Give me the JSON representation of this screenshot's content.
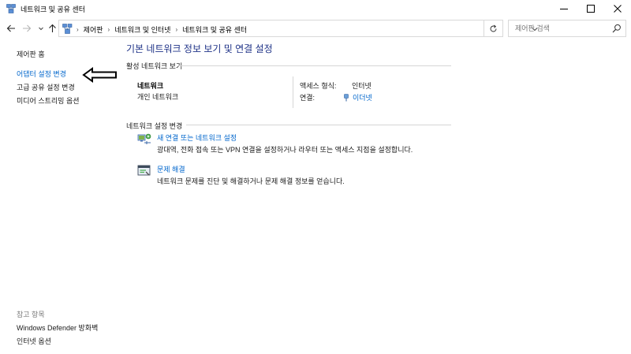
{
  "window": {
    "title": "네트워크 및 공유 센터"
  },
  "address": {
    "breadcrumbs": [
      "제어판",
      "네트워크 및 인터넷",
      "네트워크 및 공유 센터"
    ],
    "search_placeholder": "제어판 검색"
  },
  "left_pane": {
    "home": "제어판 홈",
    "links": [
      "어댑터 설정 변경",
      "고급 공유 설정 변경",
      "미디어 스트리밍 옵션"
    ],
    "see_also_header": "참고 항목",
    "see_also": [
      "Windows Defender 방화벽",
      "인터넷 옵션"
    ]
  },
  "main": {
    "title": "기본 네트워크 정보 보기 및 연결 설정",
    "active_networks_header": "활성 네트워크 보기",
    "network": {
      "name": "네트워크",
      "type": "개인 네트워크",
      "access_label": "액세스 형식:",
      "access_value": "인터넷",
      "connection_label": "연결:",
      "connection_value": "이더넷"
    },
    "change_settings_header": "네트워크 설정 변경",
    "tasks": [
      {
        "link": "새 연결 또는 네트워크 설정",
        "desc": "광대역, 전화 접속 또는 VPN 연결을 설정하거나 라우터 또는 액세스 지점을 설정합니다."
      },
      {
        "link": "문제 해결",
        "desc": "네트워크 문제를 진단 및 해결하거나 문제 해결 정보를 얻습니다."
      }
    ]
  },
  "colors": {
    "link": "#0066cc",
    "title": "#1e3287",
    "annotation_arrow": "#000000"
  },
  "icons": [
    "network-center-icon",
    "minimize-icon",
    "maximize-icon",
    "close-icon",
    "back-arrow-icon",
    "forward-arrow-icon",
    "recent-locations-icon",
    "up-arrow-icon",
    "control-panel-icon",
    "chevron-right-icon",
    "chevron-down-icon",
    "refresh-icon",
    "search-icon",
    "ethernet-icon",
    "new-connection-icon",
    "troubleshoot-icon",
    "left-arrow-annotation"
  ]
}
